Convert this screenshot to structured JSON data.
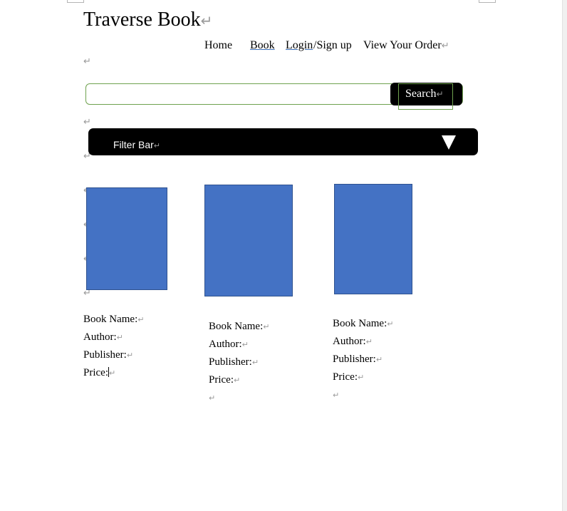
{
  "page": {
    "title": "Traverse Book",
    "paragraph_mark": "↵"
  },
  "nav": {
    "home": "Home",
    "book": "Book",
    "login": "Login",
    "signup": "/Sign up",
    "order": "View Your Order"
  },
  "search": {
    "value": "",
    "button_label": "Search"
  },
  "filter": {
    "label": "Filter Bar",
    "icon": "triangle-down-icon"
  },
  "books": [
    {
      "name_label": "Book Name:",
      "author_label": "Author:",
      "publisher_label": "Publisher:",
      "price_label": "Price:"
    },
    {
      "name_label": "Book Name:",
      "author_label": "Author:",
      "publisher_label": "Publisher:",
      "price_label": "Price:"
    },
    {
      "name_label": "Book Name:",
      "author_label": "Author:",
      "publisher_label": "Publisher:",
      "price_label": "Price:"
    }
  ],
  "colors": {
    "cover": "#4472c4",
    "cover_border": "#2f528f",
    "search_border": "#6fa24f",
    "button_bg": "#000000",
    "link_underline": "#3c6fb8"
  }
}
